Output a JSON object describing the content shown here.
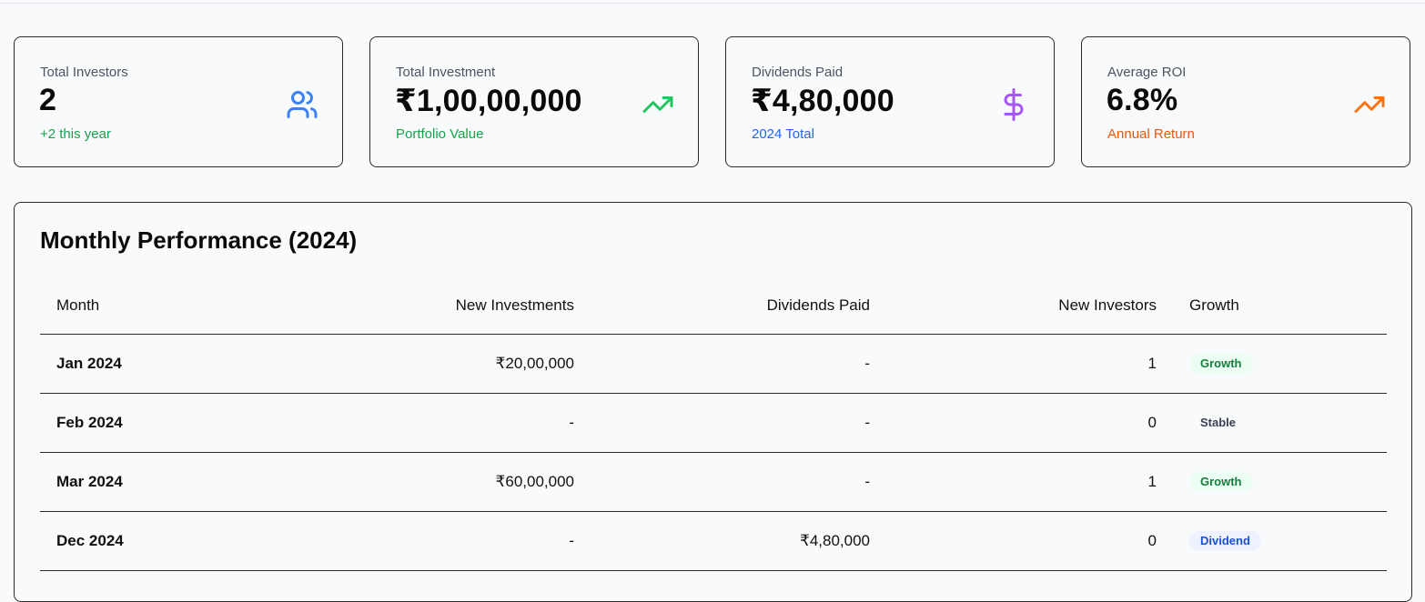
{
  "stats": [
    {
      "label": "Total Investors",
      "value": "2",
      "sub": "+2 this year",
      "sub_color": "#16a34a",
      "icon": "users-icon",
      "icon_color": "#3b82f6"
    },
    {
      "label": "Total Investment",
      "value": "₹1,00,00,000",
      "sub": "Portfolio Value",
      "sub_color": "#16a34a",
      "icon": "trending-up-icon",
      "icon_color": "#22c55e"
    },
    {
      "label": "Dividends Paid",
      "value": "₹4,80,000",
      "sub": "2024 Total",
      "sub_color": "#2563eb",
      "icon": "dollar-icon",
      "icon_color": "#a855f7"
    },
    {
      "label": "Average ROI",
      "value": "6.8%",
      "sub": "Annual Return",
      "sub_color": "#ea580c",
      "icon": "trending-up-icon",
      "icon_color": "#f97316"
    }
  ],
  "performance": {
    "title": "Monthly Performance (2024)",
    "columns": {
      "month": "Month",
      "new_investments": "New Investments",
      "dividends_paid": "Dividends Paid",
      "new_investors": "New Investors",
      "growth": "Growth"
    },
    "rows": [
      {
        "month": "Jan 2024",
        "new_investments": "₹20,00,000",
        "dividends_paid": "-",
        "new_investors": "1",
        "growth": "Growth"
      },
      {
        "month": "Feb 2024",
        "new_investments": "-",
        "dividends_paid": "-",
        "new_investors": "0",
        "growth": "Stable"
      },
      {
        "month": "Mar 2024",
        "new_investments": "₹60,00,000",
        "dividends_paid": "-",
        "new_investors": "1",
        "growth": "Growth"
      },
      {
        "month": "Dec 2024",
        "new_investments": "-",
        "dividends_paid": "₹4,80,000",
        "new_investors": "0",
        "growth": "Dividend"
      }
    ]
  },
  "badge_styles": {
    "Growth": {
      "bg": "#ecfdf3",
      "fg": "#15803d"
    },
    "Stable": {
      "bg": "transparent",
      "fg": "#374151"
    },
    "Dividend": {
      "bg": "#eef2ff",
      "fg": "#1d4ed8"
    }
  }
}
